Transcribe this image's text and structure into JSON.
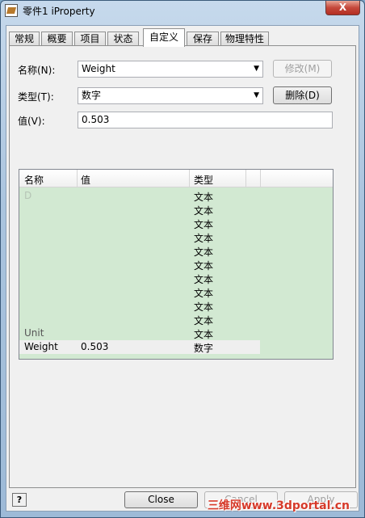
{
  "window": {
    "title": "零件1 iProperty",
    "close_glyph": "X"
  },
  "tabs": [
    {
      "label": "常规"
    },
    {
      "label": "概要"
    },
    {
      "label": "项目"
    },
    {
      "label": "状态"
    },
    {
      "label": "自定义",
      "active": true
    },
    {
      "label": "保存"
    },
    {
      "label": "物理特性"
    }
  ],
  "form": {
    "name_label": "名称(N):",
    "name_value": "Weight",
    "type_label": "类型(T):",
    "type_value": "数字",
    "value_label": "值(V):",
    "value_value": "0.503",
    "modify_button": "修改(M)",
    "delete_button": "删除(D)"
  },
  "table": {
    "headers": [
      "名称",
      "值",
      "类型"
    ],
    "rows": [
      {
        "name": "D",
        "value": "",
        "type": "文本"
      },
      {
        "name": "",
        "value": "",
        "type": "文本"
      },
      {
        "name": "",
        "value": "",
        "type": "文本"
      },
      {
        "name": "",
        "value": "",
        "type": "文本"
      },
      {
        "name": "",
        "value": "",
        "type": "文本"
      },
      {
        "name": "",
        "value": "",
        "type": "文本"
      },
      {
        "name": "",
        "value": "",
        "type": "文本"
      },
      {
        "name": "",
        "value": "",
        "type": "文本"
      },
      {
        "name": "",
        "value": "",
        "type": "文本"
      },
      {
        "name": "",
        "value": "",
        "type": "文本"
      },
      {
        "name": "Unit",
        "value": "",
        "type": "文本"
      },
      {
        "name": "Weight",
        "value": "0.503",
        "type": "数字",
        "selected": true
      }
    ]
  },
  "footer": {
    "help_glyph": "?",
    "close_button": "Close",
    "cancel_button": "Cancel",
    "apply_button": "Apply"
  },
  "watermark": "三维网www.3dportal.cn"
}
